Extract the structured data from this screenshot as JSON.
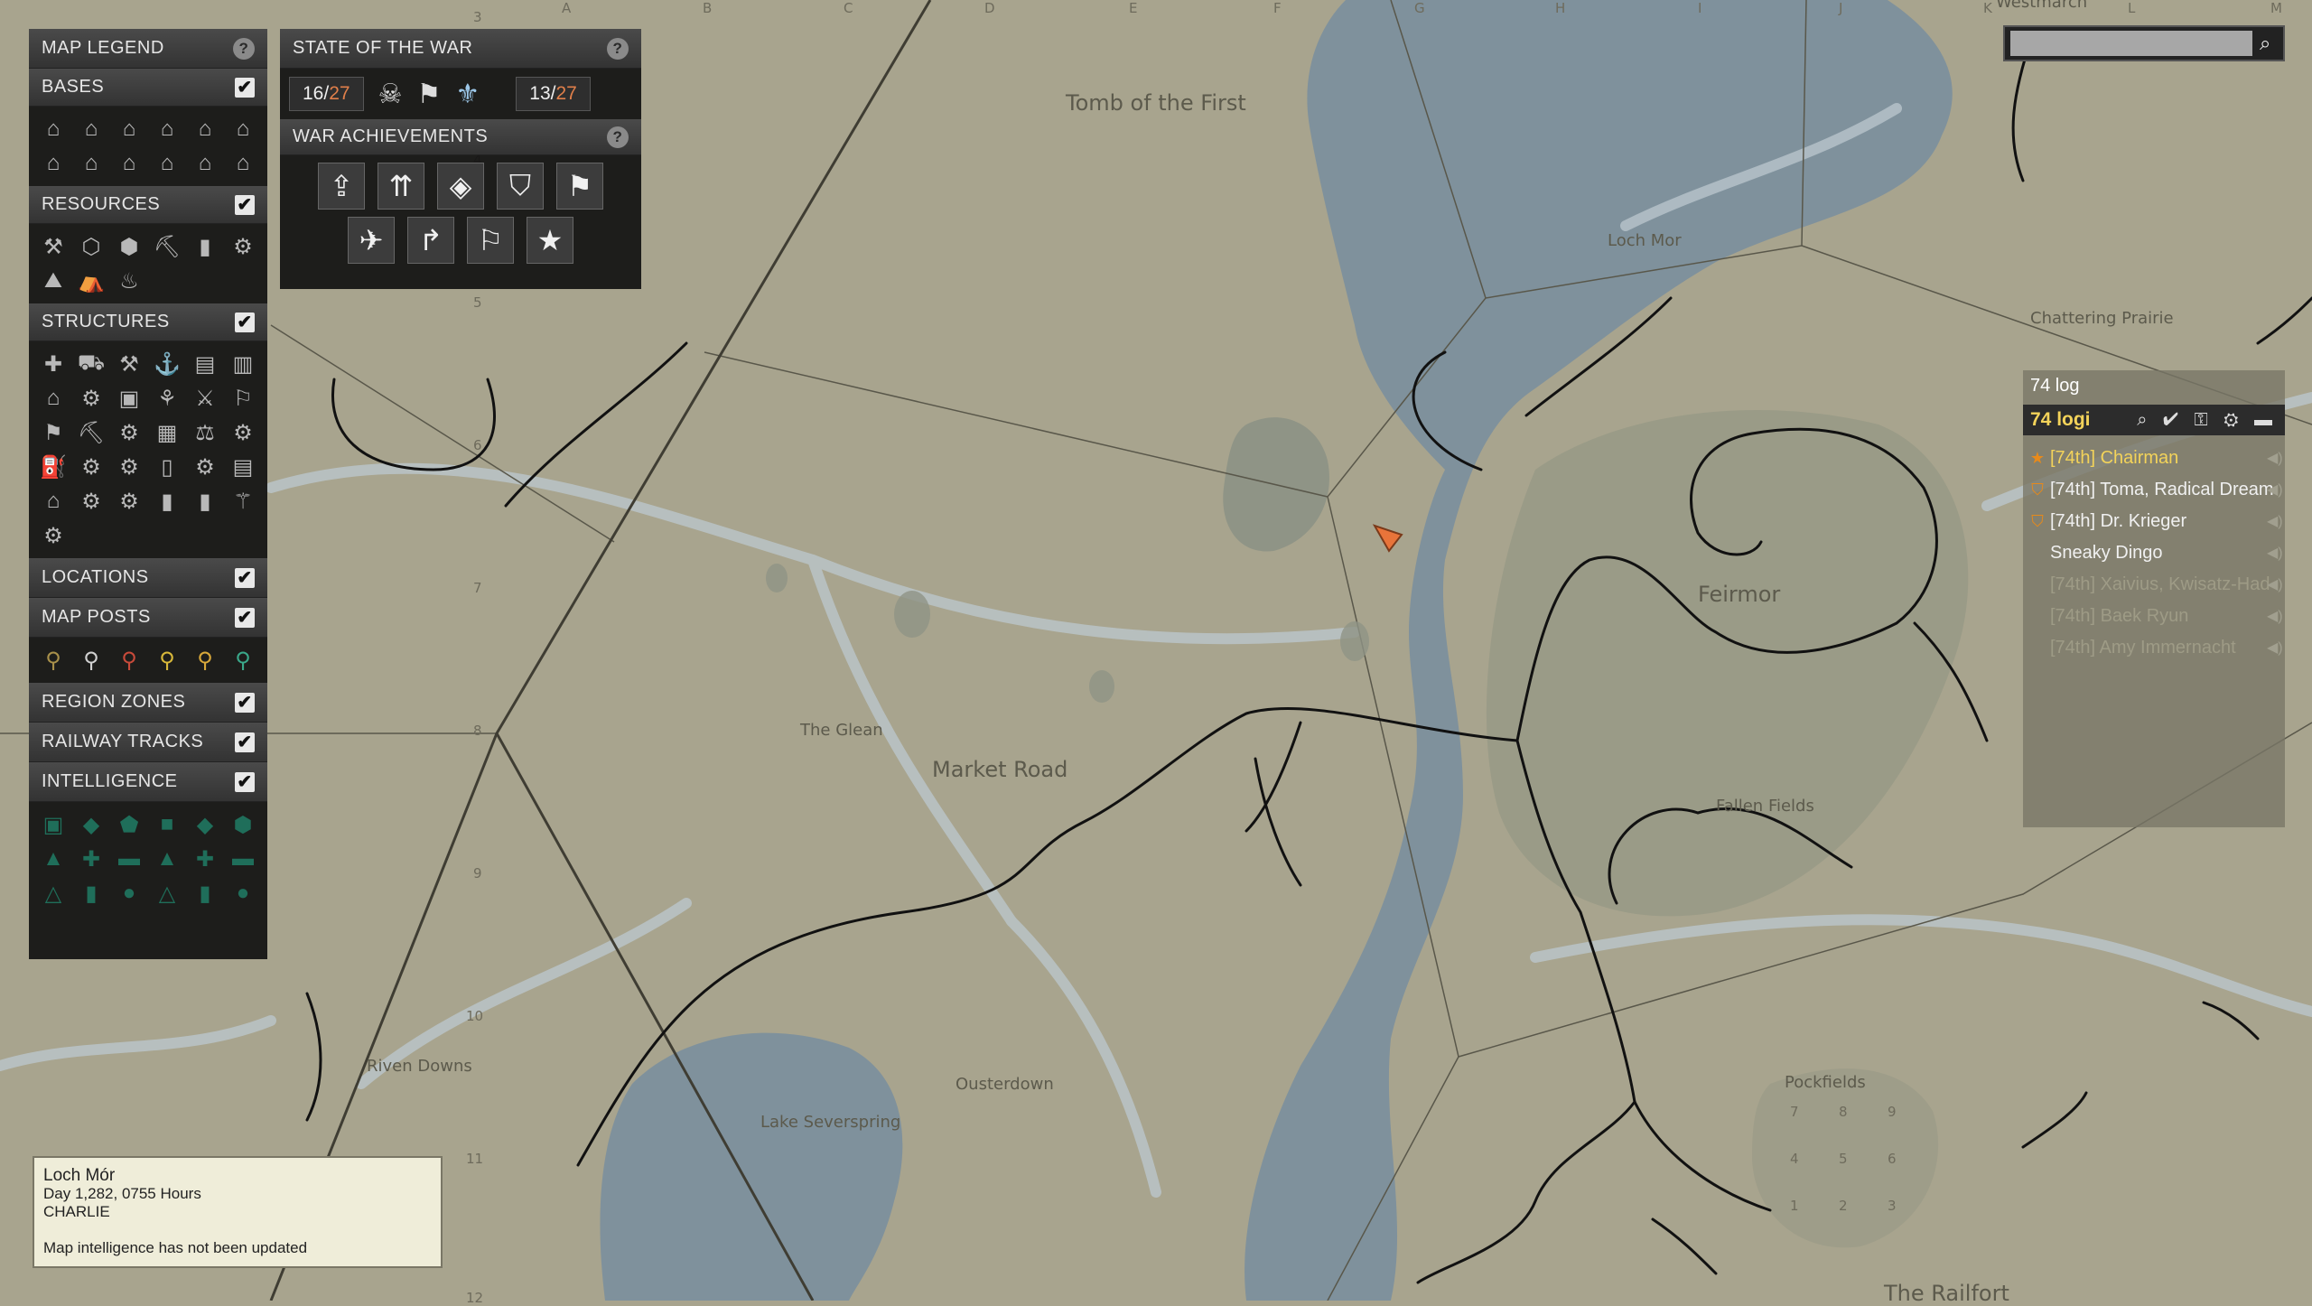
{
  "map": {
    "labels": {
      "tomb": "Tomb of the First",
      "loch_mor": "Loch Mor",
      "chattering": "Chattering Prairie",
      "feirmor": "Feirmor",
      "fallen_fields": "Fallen Fields",
      "the_glean": "The Glean",
      "market_road": "Market Road",
      "riven_downs": "Riven Downs",
      "ousterdown": "Ousterdown",
      "lake_severspring": "Lake Severspring",
      "pockfields": "Pockfields",
      "the_railfort": "The Railfort",
      "westmarch": "Westmarch"
    },
    "columns": [
      "A",
      "B",
      "C",
      "D",
      "E",
      "F",
      "G",
      "H",
      "I",
      "J",
      "K",
      "L",
      "M"
    ],
    "rows": [
      "3",
      "4",
      "5",
      "6",
      "7",
      "8",
      "9",
      "10",
      "11",
      "12"
    ],
    "keypad": [
      "7",
      "8",
      "9",
      "4",
      "5",
      "6",
      "1",
      "2",
      "3"
    ],
    "colors": {
      "land": "#a8a48e",
      "water": "#7d8f9b",
      "road": "#bfcbd2",
      "town": "#969884",
      "player": "#e8743a"
    }
  },
  "legend": {
    "title": "MAP LEGEND",
    "sections": {
      "bases": "BASES",
      "resources": "RESOURCES",
      "structures": "STRUCTURES",
      "locations": "LOCATIONS",
      "map_posts": "MAP POSTS",
      "region_zones": "REGION ZONES",
      "railway_tracks": "RAILWAY TRACKS",
      "intelligence": "INTELLIGENCE"
    },
    "checkmark": "✔",
    "help": "?",
    "icons": {
      "bases": [
        "⌂",
        "⌂",
        "⌂",
        "⌂",
        "⌂",
        "⌂",
        "⌂",
        "⌂",
        "⌂",
        "⌂",
        "⌂",
        "⌂"
      ],
      "resources": [
        "⚒",
        "⬡",
        "⬢",
        "⛏",
        "▮",
        "⚙",
        "⛰",
        "⛺",
        "♨"
      ],
      "structures": [
        "✚",
        "⛟",
        "⚒",
        "⚓",
        "▤",
        "▥",
        "⌂",
        "⚙",
        "▣",
        "⚘",
        "⚔",
        "⚐",
        "⚑",
        "⛏",
        "⚙",
        "▦",
        "⚖",
        "⚙",
        "⛽",
        "⚙",
        "⚙",
        "▯",
        "⚙",
        "▤",
        "⌂",
        "⚙",
        "⚙",
        "▮",
        "▮",
        "⚚",
        "⚙"
      ],
      "map_posts": [
        "⚲",
        "⚲",
        "⚲",
        "⚲",
        "⚲",
        "⚲"
      ],
      "intelligence": [
        "▣",
        "◆",
        "⬟",
        "■",
        "◆",
        "⬢",
        "▲",
        "✚",
        "▬",
        "▲",
        "✚",
        "▬",
        "△",
        "▮",
        "●",
        "△",
        "▮",
        "●"
      ]
    }
  },
  "war": {
    "title": "STATE OF THE WAR",
    "left_count": "16",
    "right_count": "13",
    "total": "27",
    "divider": "/",
    "achievements_title": "WAR ACHIEVEMENTS",
    "help": "?",
    "achievement_icons": [
      "⇪",
      "⇈",
      "◈",
      "⛉",
      "⚑",
      "✈",
      "↱",
      "⚐",
      "★"
    ],
    "faction_icons": [
      "☠",
      "⚑",
      "⚜"
    ]
  },
  "search": {
    "value": "",
    "placeholder": "",
    "icon": "⌕"
  },
  "squad": {
    "tag": "74 log",
    "name": "74 logi",
    "tools": "⌕ ✔ ⚿ ⚙ ▬",
    "members": [
      {
        "name": "[74th] Chairman",
        "badge": "★",
        "color": "#f3d35a"
      },
      {
        "name": "[74th] Toma, Radical Dream",
        "badge": "⛉",
        "color": "#f0f0f0"
      },
      {
        "name": "[74th] Dr. Krieger",
        "badge": "⛉",
        "color": "#f0f0f0"
      },
      {
        "name": "Sneaky Dingo",
        "badge": "",
        "color": "#f0f0f0"
      },
      {
        "name": "[74th] Xaivius, Kwisatz-Had",
        "badge": "",
        "color": "#9e9b86"
      },
      {
        "name": "[74th] Baek Ryun",
        "badge": "",
        "color": "#9e9b86"
      },
      {
        "name": "[74th] Amy Immernacht",
        "badge": "",
        "color": "#9e9b86"
      }
    ],
    "volume_icon": "◀)"
  },
  "info": {
    "region": "Loch Mór",
    "day": "Day 1,282, 0755 Hours",
    "shard": "CHARLIE",
    "status": "Map intelligence has not been updated"
  }
}
